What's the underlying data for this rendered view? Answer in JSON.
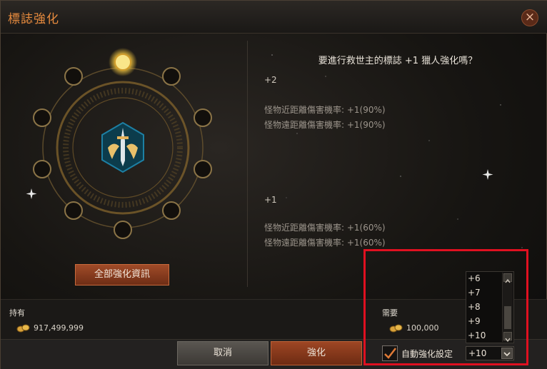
{
  "window": {
    "title": "標誌強化",
    "close_label": "×"
  },
  "question": "要進行救世主的標誌 +1 獵人強化嗎？",
  "next_level": {
    "label": "+2",
    "stats": [
      "怪物近距離傷害機率: +1(90%)",
      "怪物遠距離傷害機率: +1(90%)"
    ]
  },
  "current_level": {
    "label": "+1",
    "stats": [
      "怪物近距離傷害機率: +1(60%)",
      "怪物遠距離傷害機率: +1(60%)"
    ]
  },
  "all_info_button": "全部強化資訊",
  "owned": {
    "label": "持有",
    "amount": "917,499,999"
  },
  "required": {
    "label": "需要",
    "amount": "100,000"
  },
  "buttons": {
    "cancel": "取消",
    "enhance": "強化"
  },
  "auto_enhance": {
    "label": "自動強化設定",
    "checked": true
  },
  "level_select": {
    "value": "+10",
    "options": [
      "+6",
      "+7",
      "+8",
      "+9",
      "+10"
    ]
  },
  "colors": {
    "accent": "#e78b3e",
    "highlight": "#e01020",
    "gold": "#d9a23a"
  },
  "icons": [
    "close-icon",
    "crossed-sword-emblem-icon",
    "gold-coin-icon",
    "checkmark-icon",
    "chevron-down-icon",
    "chevron-up-icon"
  ]
}
